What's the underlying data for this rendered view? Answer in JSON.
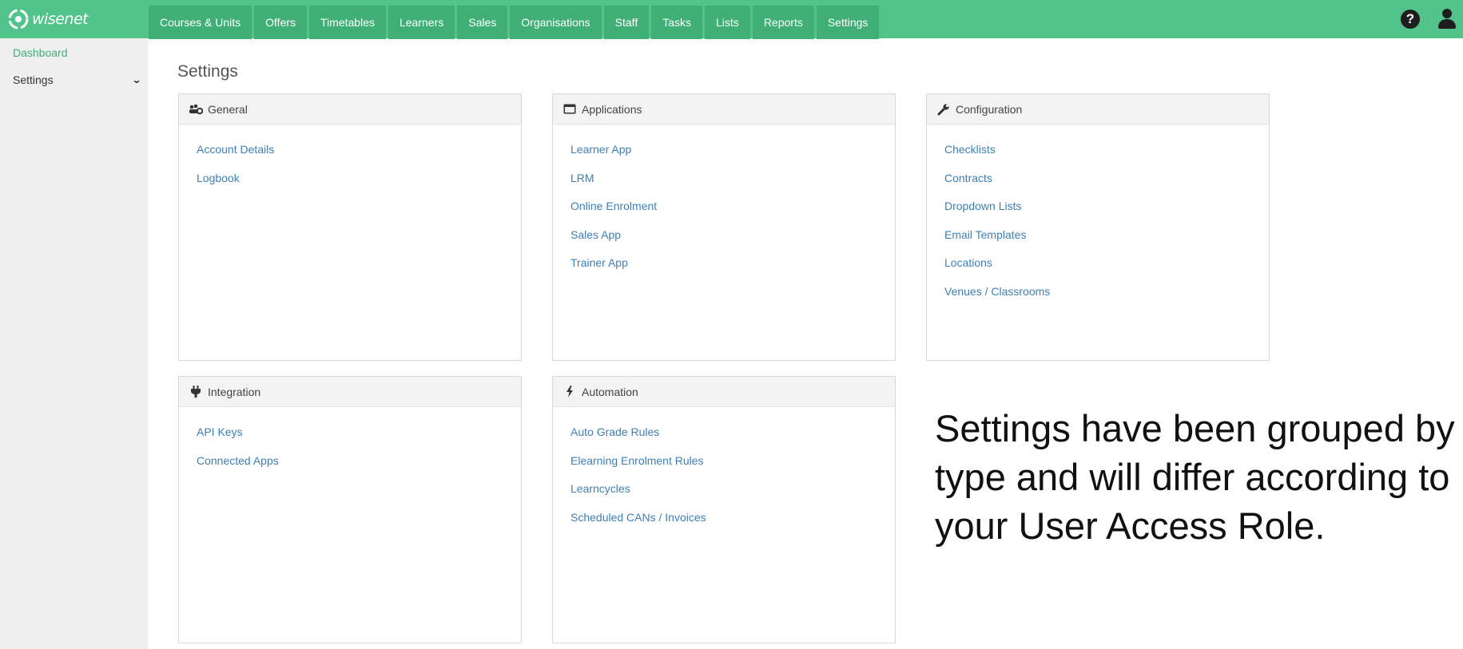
{
  "app": {
    "logo_text": "wisenet",
    "colors": {
      "brand": "#52c48b",
      "brand_dark": "#3faf76",
      "link": "#3e7fb6"
    }
  },
  "nav": {
    "items": [
      {
        "label": "Courses & Units"
      },
      {
        "label": "Offers"
      },
      {
        "label": "Timetables"
      },
      {
        "label": "Learners"
      },
      {
        "label": "Sales"
      },
      {
        "label": "Organisations"
      },
      {
        "label": "Staff"
      },
      {
        "label": "Tasks"
      },
      {
        "label": "Lists"
      },
      {
        "label": "Reports"
      },
      {
        "label": "Settings"
      }
    ],
    "icons": {
      "help": "question-circle-icon",
      "user": "user-icon"
    }
  },
  "sidebar": {
    "dashboard_label": "Dashboard",
    "settings_label": "Settings",
    "settings_icon": "chevron-down-icon"
  },
  "main": {
    "title": "Settings",
    "panels": [
      {
        "title": "General",
        "icon": "users-cog-icon",
        "links": [
          "Account Details",
          "Logbook"
        ]
      },
      {
        "title": "Applications",
        "icon": "window-icon",
        "links": [
          "Learner App",
          "LRM",
          "Online Enrolment",
          "Sales App",
          "Trainer App"
        ]
      },
      {
        "title": "Configuration",
        "icon": "wrench-icon",
        "links": [
          "Checklists",
          "Contracts",
          "Dropdown Lists",
          "Email Templates",
          "Locations",
          "Venues / Classrooms"
        ]
      },
      {
        "title": "Integration",
        "icon": "plug-icon",
        "links": [
          "API Keys",
          "Connected Apps"
        ]
      },
      {
        "title": "Automation",
        "icon": "bolt-icon",
        "links": [
          "Auto Grade Rules",
          "Elearning Enrolment Rules",
          "Learncycles",
          "Scheduled CANs / Invoices"
        ]
      }
    ]
  },
  "caption": "Settings have been grouped by type and will differ according to your User Access Role."
}
